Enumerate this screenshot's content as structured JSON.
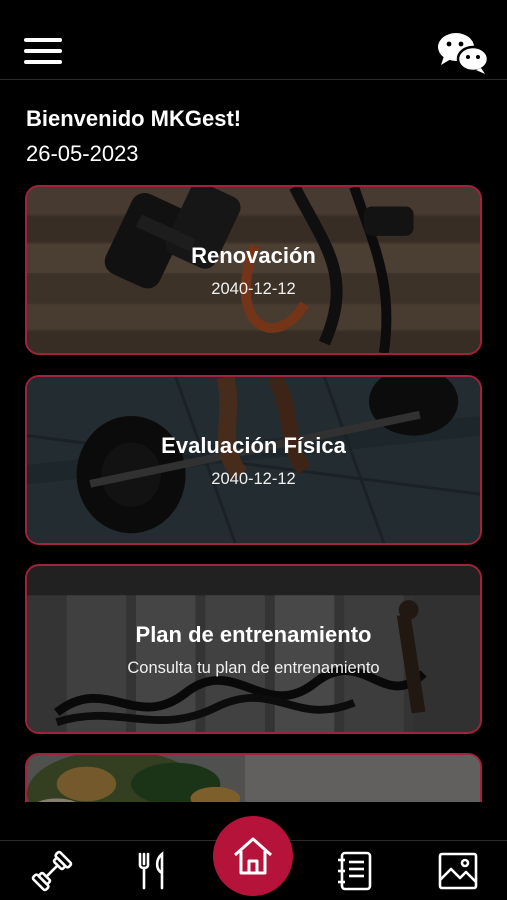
{
  "header": {
    "menu_icon": "hamburger-menu-icon",
    "chat_icon": "chat-bubbles-icon"
  },
  "welcome": {
    "greeting": "Bienvenido MKGest!",
    "date": "26-05-2023"
  },
  "cards": [
    {
      "title": "Renovación",
      "subtitle": "2040-12-12"
    },
    {
      "title": "Evaluación Física",
      "subtitle": "2040-12-12"
    },
    {
      "title": "Plan de entrenamiento",
      "subtitle": "Consulta tu plan de entrenamiento"
    },
    {
      "title": "",
      "subtitle": ""
    }
  ],
  "bottom_nav": [
    {
      "icon": "dumbbell-icon"
    },
    {
      "icon": "fork-knife-icon"
    },
    {
      "icon": "home-icon"
    },
    {
      "icon": "notebook-icon"
    },
    {
      "icon": "gallery-icon"
    }
  ],
  "colors": {
    "background": "#000000",
    "accent": "#b5133a",
    "card_border": "#a3213a",
    "text": "#ffffff"
  }
}
